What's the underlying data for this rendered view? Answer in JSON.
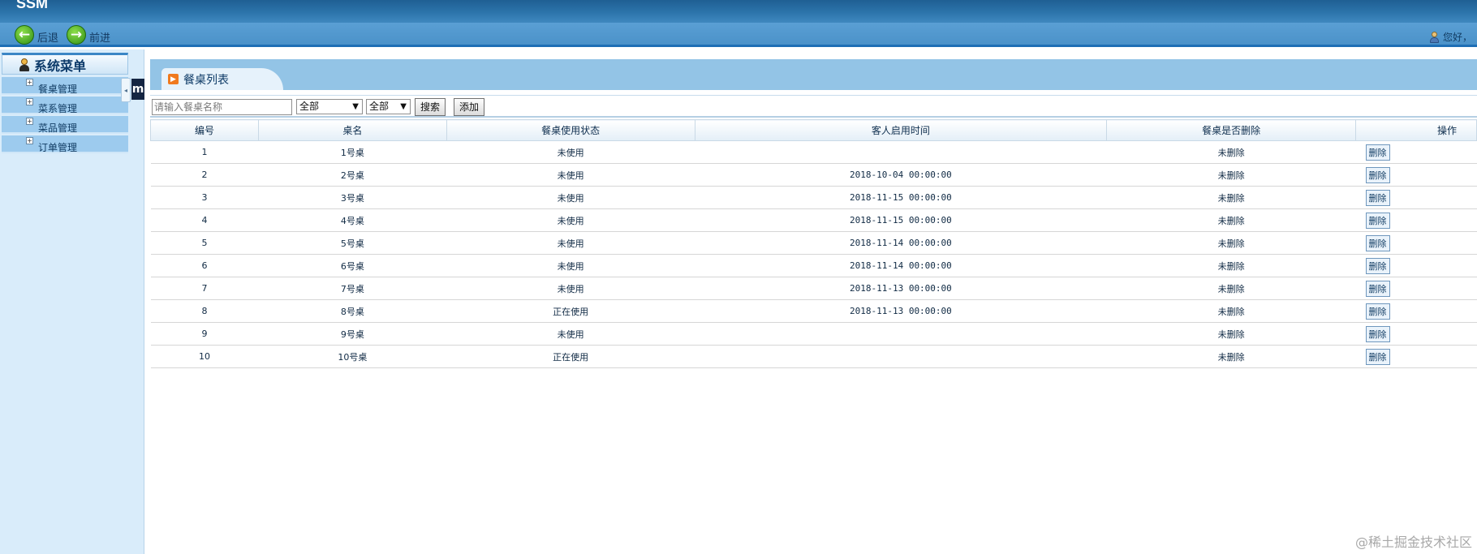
{
  "app": {
    "banner_title": "SSM"
  },
  "navbar": {
    "back_label": "后退",
    "forward_label": "前进",
    "greeting": "您好，"
  },
  "sidebar": {
    "header": "系统菜单",
    "collapse_glyph": "◂",
    "badge": "m",
    "items": [
      {
        "label": "餐桌管理"
      },
      {
        "label": "菜系管理"
      },
      {
        "label": "菜品管理"
      },
      {
        "label": "订单管理"
      }
    ]
  },
  "page": {
    "title": "餐桌列表"
  },
  "toolbar": {
    "search_placeholder": "请输入餐桌名称",
    "filter1_value": "全部",
    "filter2_value": "全部",
    "search_label": "搜索",
    "add_label": "添加"
  },
  "table": {
    "headers": [
      "编号",
      "桌名",
      "餐桌使用状态",
      "客人启用时间",
      "餐桌是否删除",
      "操作"
    ],
    "action_label": "删除",
    "rows": [
      {
        "id": "1",
        "name": "1号桌",
        "status": "未使用",
        "time": "",
        "deleted": "未删除"
      },
      {
        "id": "2",
        "name": "2号桌",
        "status": "未使用",
        "time": "2018-10-04 00:00:00",
        "deleted": "未删除"
      },
      {
        "id": "3",
        "name": "3号桌",
        "status": "未使用",
        "time": "2018-11-15 00:00:00",
        "deleted": "未删除"
      },
      {
        "id": "4",
        "name": "4号桌",
        "status": "未使用",
        "time": "2018-11-15 00:00:00",
        "deleted": "未删除"
      },
      {
        "id": "5",
        "name": "5号桌",
        "status": "未使用",
        "time": "2018-11-14 00:00:00",
        "deleted": "未删除"
      },
      {
        "id": "6",
        "name": "6号桌",
        "status": "未使用",
        "time": "2018-11-14 00:00:00",
        "deleted": "未删除"
      },
      {
        "id": "7",
        "name": "7号桌",
        "status": "未使用",
        "time": "2018-11-13 00:00:00",
        "deleted": "未删除"
      },
      {
        "id": "8",
        "name": "8号桌",
        "status": "正在使用",
        "time": "2018-11-13 00:00:00",
        "deleted": "未删除"
      },
      {
        "id": "9",
        "name": "9号桌",
        "status": "未使用",
        "time": "",
        "deleted": "未删除"
      },
      {
        "id": "10",
        "name": "10号桌",
        "status": "正在使用",
        "time": "",
        "deleted": "未删除"
      }
    ]
  },
  "watermark": "@稀土掘金技术社区",
  "colors": {
    "banner": "#2c74ab",
    "navbar": "#5a9fd4",
    "sidebar": "#d9ecfa",
    "menu_item": "#9dcbee",
    "title_bar": "#93c4e6"
  }
}
